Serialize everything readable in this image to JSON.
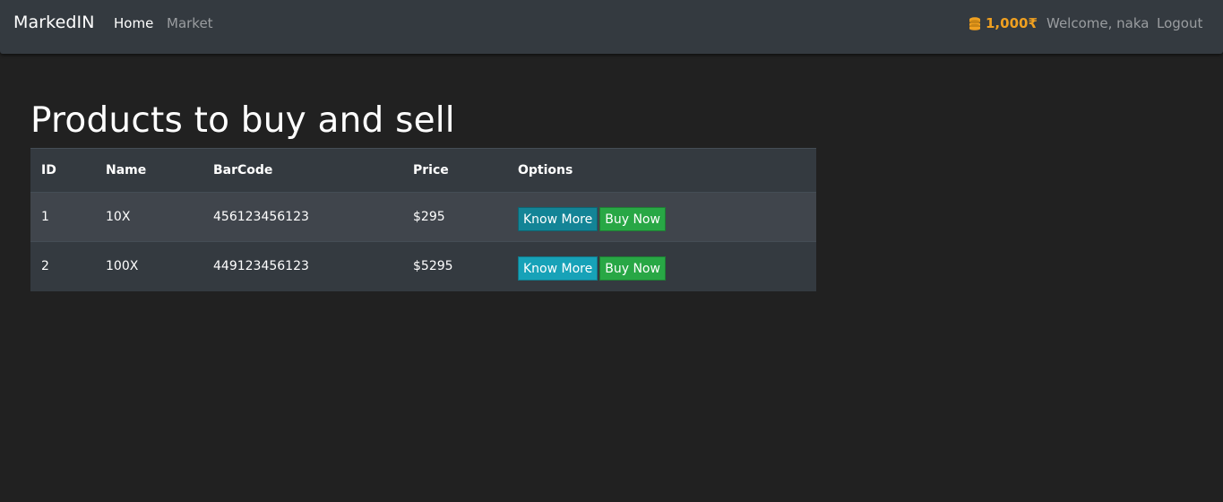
{
  "navbar": {
    "brand": "MarkedIN",
    "links": [
      "Home",
      "Market"
    ],
    "budget": "1,000₹",
    "budget_icon": "coins-icon",
    "welcome": "Welcome, naka",
    "logout": "Logout"
  },
  "main": {
    "title": "Products to buy and sell",
    "table": {
      "headers": [
        "ID",
        "Name",
        "BarCode",
        "Price",
        "Options"
      ],
      "rows": [
        {
          "id": "1",
          "name": "10X",
          "barcode": "456123456123",
          "price": "$295",
          "know_more": "Know More",
          "buy_now": "Buy Now"
        },
        {
          "id": "2",
          "name": "100X",
          "barcode": "449123456123",
          "price": "$5295",
          "know_more": "Know More",
          "buy_now": "Buy Now"
        }
      ]
    }
  },
  "colors": {
    "navbar_bg": "#343a40",
    "page_bg": "#212121",
    "budget": "#f0a020",
    "info": "#17a2b8",
    "success": "#28a745"
  }
}
